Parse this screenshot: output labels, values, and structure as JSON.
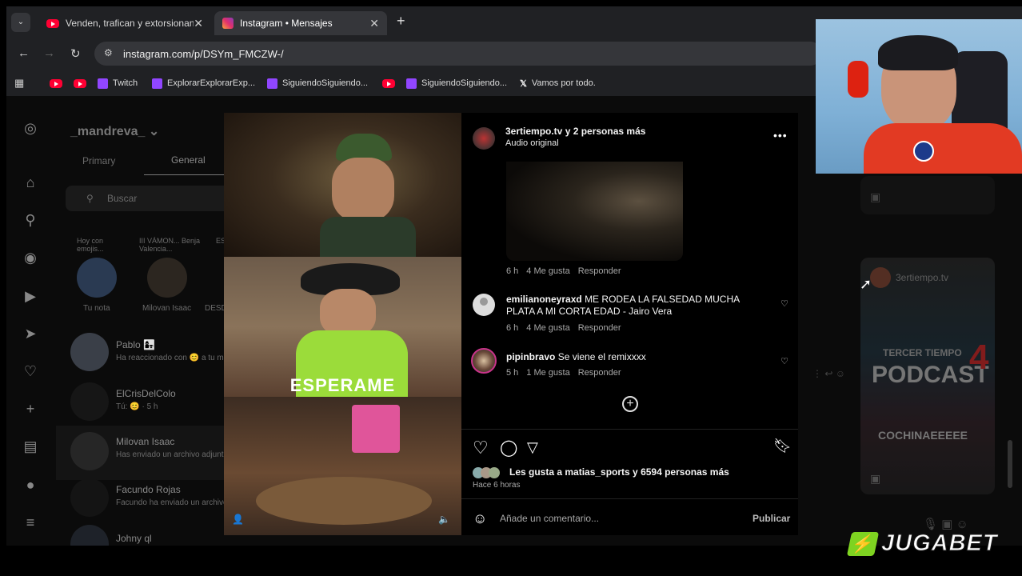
{
  "browser": {
    "tabs": [
      {
        "title": "Venden, trafican y extorsionan:",
        "icon": "youtube-icon"
      },
      {
        "title": "Instagram • Mensajes",
        "icon": "instagram-icon"
      }
    ],
    "url": "instagram.com/p/DSYm_FMCZW-/",
    "bookmarks": [
      {
        "label": "",
        "icon": "youtube-icon"
      },
      {
        "label": "",
        "icon": "youtube-icon"
      },
      {
        "label": "Twitch",
        "icon": "twitch-icon"
      },
      {
        "label": "ExplorarExplorarExp...",
        "icon": "twitch-icon"
      },
      {
        "label": "SiguiendoSiguiendo...",
        "icon": "twitch-icon"
      },
      {
        "label": "",
        "icon": "youtube-icon"
      },
      {
        "label": "SiguiendoSiguiendo...",
        "icon": "twitch-icon"
      },
      {
        "label": "Vamos por todo.",
        "icon": "x-icon"
      }
    ]
  },
  "dm": {
    "username": "_mandreva_",
    "tabs": [
      "Primary",
      "General"
    ],
    "search_placeholder": "Buscar",
    "notes": [
      {
        "text": "Hoy con emojis...",
        "name": "Tu nota"
      },
      {
        "text": "III VÁMON... Benja Valencia...",
        "name": "Milovan Isaac"
      },
      {
        "text": "ES...",
        "name": "DESD"
      }
    ],
    "threads": [
      {
        "name": "Pablo 👩‍👧",
        "preview": "Ha reaccionado con 😊 a tu m"
      },
      {
        "name": "ElCrisDelColo",
        "preview": "Tú: 😊 · 5 h"
      },
      {
        "name": "Milovan Isaac",
        "preview": "Has enviado un archivo adjunt"
      },
      {
        "name": "Facundo Rojas",
        "preview": "Facundo ha enviado un archivo"
      },
      {
        "name": "Johny ql",
        "preview": ""
      }
    ]
  },
  "post": {
    "author": "3ertiempo.tv y 2 personas más",
    "audio": "Audio original",
    "reply_meta": {
      "time": "6 h",
      "likes": "4 Me gusta",
      "reply": "Responder"
    },
    "comments": [
      {
        "user": "emilianoneyraxd",
        "text": "ME RODEA LA FALSEDAD MUCHA PLATA A MI CORTA EDAD - Jairo Vera",
        "time": "6 h",
        "likes": "4 Me gusta",
        "reply": "Responder"
      },
      {
        "user": "pipinbravo",
        "text": "Se viene el remixxxx",
        "time": "5 h",
        "likes": "1 Me gusta",
        "reply": "Responder"
      }
    ],
    "likes_text": "Les gusta a matias_sports y 6594 personas más",
    "time_ago": "Hace 6 horas",
    "comment_placeholder": "Añade un comentario...",
    "publish": "Publicar",
    "media_caption": "ESPERAME"
  },
  "right_panel": {
    "shared_account": "3ertiempo.tv",
    "podcast_title_1": "TERCER TIEMPO",
    "podcast_title_2": "PODCAST",
    "podcast_number": "4",
    "podcast_host": "COCHINAEEEEE"
  },
  "overlay_brand": {
    "text": "JUGABET"
  }
}
